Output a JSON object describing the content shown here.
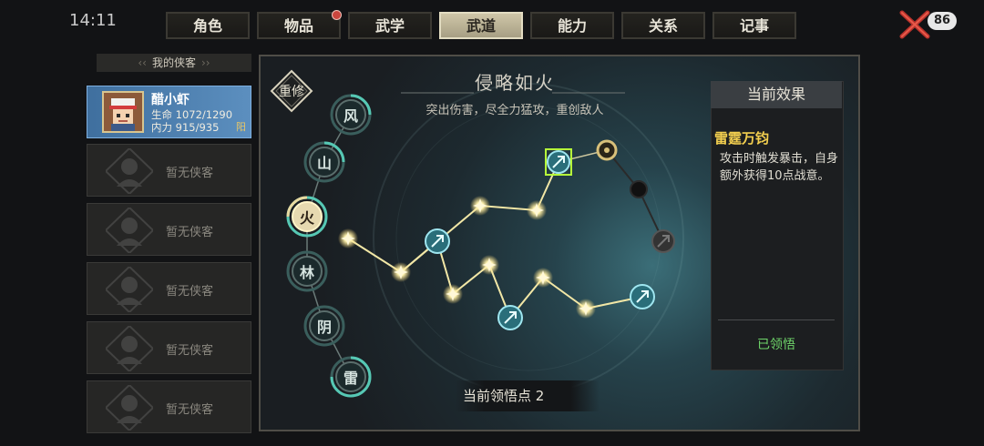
{
  "status_bar": {
    "time": "14:11",
    "badge": "86"
  },
  "tabs": [
    {
      "label": "角色",
      "active": false,
      "alert": false
    },
    {
      "label": "物品",
      "active": false,
      "alert": true
    },
    {
      "label": "武学",
      "active": false,
      "alert": false
    },
    {
      "label": "武道",
      "active": true,
      "alert": false
    },
    {
      "label": "能力",
      "active": false,
      "alert": false
    },
    {
      "label": "关系",
      "active": false,
      "alert": false
    },
    {
      "label": "记事",
      "active": false,
      "alert": false
    }
  ],
  "roster": {
    "header": "我的侠客",
    "selected": {
      "name": "醋小虾",
      "hp": "生命 1072/1290",
      "mp": "内力 915/935",
      "tag": "阳"
    },
    "empty_label": "暂无侠客",
    "empty_slots": [
      "暂无侠客",
      "暂无侠客",
      "暂无侠客",
      "暂无侠客",
      "暂无侠客"
    ]
  },
  "main": {
    "reforge_label": "重修",
    "title": "侵略如火",
    "subtitle": "突出伤害，尽全力猛攻，重创敌人",
    "stances": [
      "风",
      "山",
      "火",
      "林",
      "阴",
      "雷"
    ],
    "active_stance": "火",
    "points_label": "当前领悟点 2"
  },
  "effect": {
    "header": "当前效果",
    "name": "雷霆万钧",
    "description": "攻击时触发暴击，自身额外获得10点战意。",
    "status": "已领悟"
  },
  "colors": {
    "accent_gold": "#f3cf4f",
    "active_tab": "#cfc6a8",
    "learned_green": "#6fd66a",
    "selected_slot": "#5c8fbf"
  }
}
